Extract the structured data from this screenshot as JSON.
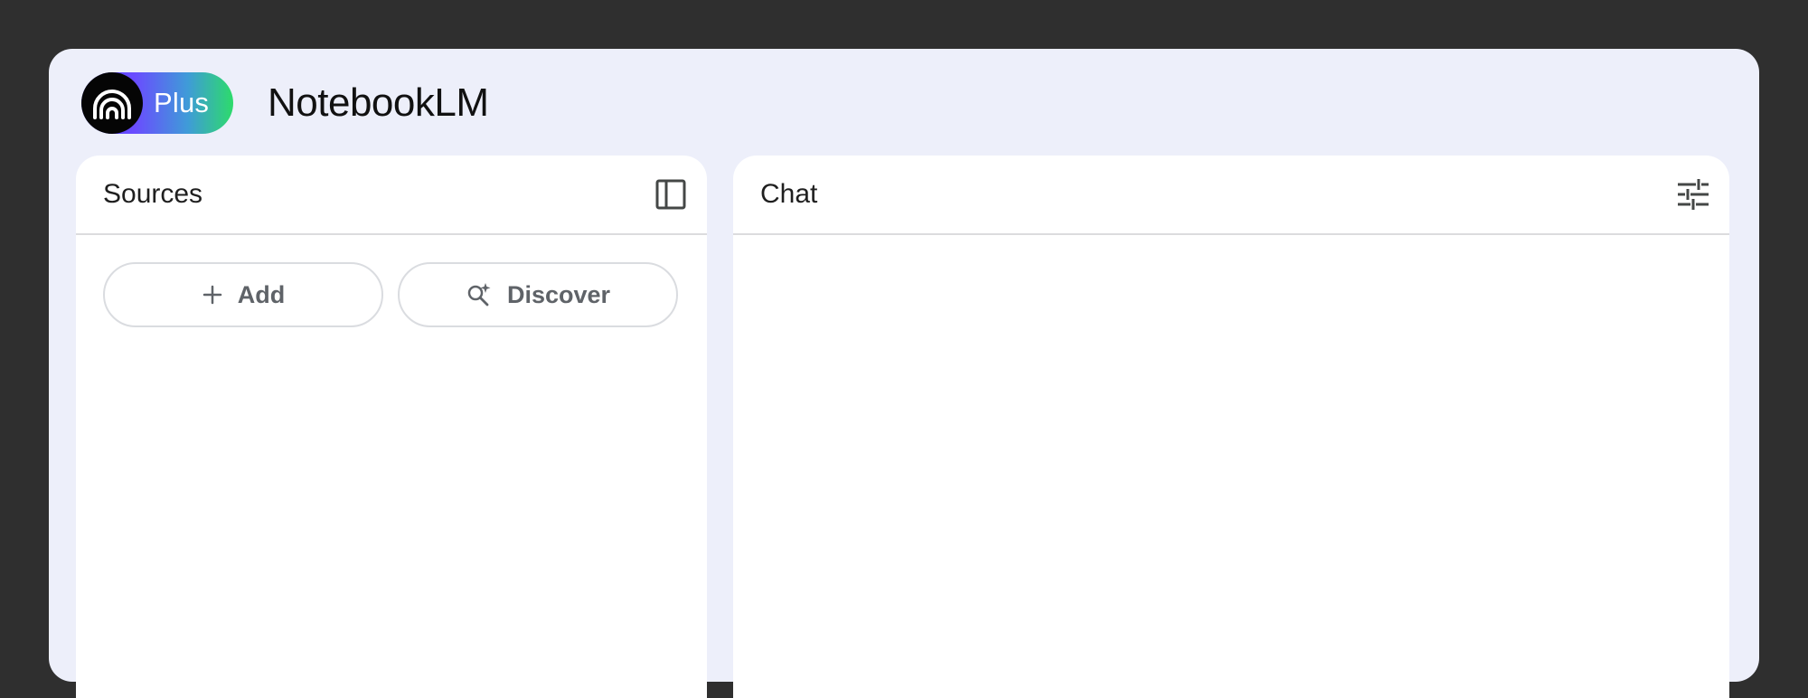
{
  "header": {
    "plan_label": "Plus",
    "app_title": "NotebookLM"
  },
  "sources_panel": {
    "title": "Sources",
    "toggle_icon": "panel-sidebar-icon",
    "buttons": [
      {
        "label": "Add",
        "icon": "plus-icon"
      },
      {
        "label": "Discover",
        "icon": "search-sparkle-icon"
      }
    ]
  },
  "chat_panel": {
    "title": "Chat",
    "settings_icon": "tune-sliders-icon"
  },
  "colors": {
    "outer_background": "#2f2f2f",
    "app_background": "#edeffa",
    "panel_background": "#ffffff",
    "text_muted": "#5f6368"
  }
}
